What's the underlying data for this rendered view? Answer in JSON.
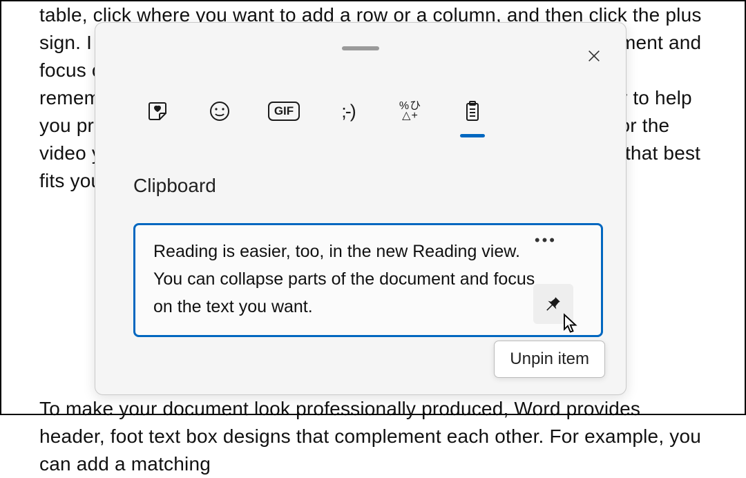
{
  "doc": {
    "para1": "table, click where you want to add a row or a column, and then click the plus sign. I  in the new Reading view. You can collapse parts of the document and focus on the  need to stop reading before you reach the end, Word remembers where you left of  device. Video provides a powerful way to help you prove your point. When you clic  can paste in the embed code for the video you want to add. You can also type a key  online for the video that best fits your document.",
    "para2": "To make your document look professionally produced, Word provides header, foot  text box designs that complement each other. For example, you can add a matching"
  },
  "panel": {
    "title": "Clipboard",
    "tabs": {
      "gif_label": "GIF",
      "kaomoji_label": ";-)",
      "symbols_line1": "%ひ",
      "symbols_line2": "△+"
    },
    "item_text": "Reading is easier, too, in the new Reading view. You can collapse parts of the document and focus on the text you want.",
    "more_glyph": "•••",
    "tooltip": "Unpin item"
  }
}
